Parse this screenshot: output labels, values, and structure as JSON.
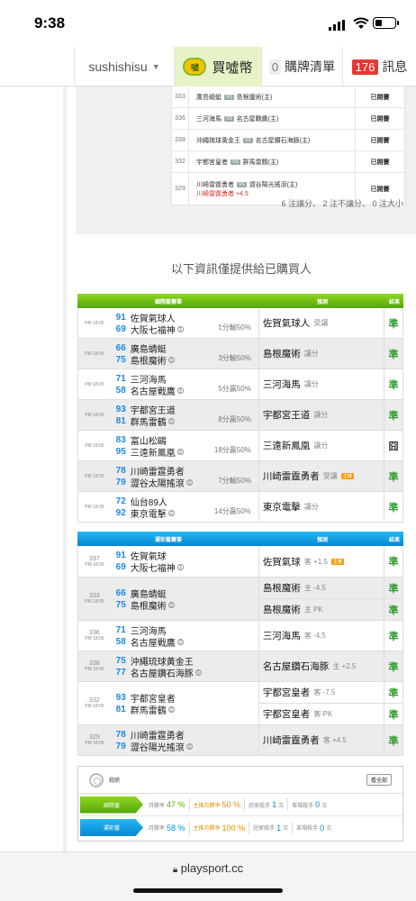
{
  "status": {
    "time": "9:38"
  },
  "nav": {
    "username": "sushishisu",
    "coin_label": "買噓幣",
    "coin_icon_text": "噓",
    "cart_count": "0",
    "cart_label": "購牌清單",
    "msg_count": "176",
    "msg_label": "訊息"
  },
  "prev": {
    "rows": [
      {
        "num": "333",
        "a": "廣島蜻蜓",
        "b": "島根魔術(主)",
        "res": "已開賽"
      },
      {
        "num": "336",
        "a": "三河海馬",
        "b": "名古屋戰鷹(主)",
        "res": "已開賽"
      },
      {
        "num": "338",
        "a": "沖繩琉球黃金王",
        "b": "名古屋鑽石海豚(主)",
        "res": "已開賽"
      },
      {
        "num": "332",
        "a": "宇都宮皇者",
        "b": "群馬雷鶴(主)",
        "res": "已開賽"
      },
      {
        "num": "329",
        "a": "川崎雷霆勇者",
        "b": "澀谷陽光搖滾(主)",
        "res": "已開賽",
        "extra": "川崎雷霆勇者 +4.5"
      }
    ],
    "summary": "6 注讓分、 2 注不讓分、 0 注大小"
  },
  "heading": "以下資訊僅提供給已購買人",
  "t_intl": {
    "h1": "國際盤賽事",
    "h2": "預測",
    "h3": "結果",
    "rows": [
      {
        "time": "PM 18:05",
        "s1": "91",
        "t1": "佐賀氣球人",
        "s2": "69",
        "t2": "大阪七福神",
        "line": "1分輸50%",
        "picks": [
          {
            "name": "佐賀氣球人",
            "x": "受讓"
          }
        ],
        "out": "準"
      },
      {
        "time": "PM 18:05",
        "s1": "66",
        "t1": "廣島蜻蜓",
        "s2": "75",
        "t2": "島根魔術",
        "line": "3分輸50%",
        "picks": [
          {
            "name": "島根魔術",
            "x": "讓分"
          }
        ],
        "out": "準"
      },
      {
        "time": "PM 18:05",
        "s1": "71",
        "t1": "三河海馬",
        "s2": "58",
        "t2": "名古屋戰鷹",
        "line": "5分贏50%",
        "picks": [
          {
            "name": "三河海馬",
            "x": "讓分"
          }
        ],
        "out": "準"
      },
      {
        "time": "PM 18:05",
        "s1": "93",
        "t1": "宇都宮王道",
        "s2": "81",
        "t2": "群馬雷鶴",
        "line": "8分贏50%",
        "picks": [
          {
            "name": "宇都宮王道",
            "x": "讓分"
          }
        ],
        "out": "準"
      },
      {
        "time": "PM 18:05",
        "s1": "83",
        "t1": "富山松鷗",
        "s2": "95",
        "t2": "三遠新鳳凰",
        "line": "18分贏50%",
        "picks": [
          {
            "name": "三遠新鳳凰",
            "x": "讓分"
          }
        ],
        "out": "囧"
      },
      {
        "time": "PM 18:05",
        "s1": "78",
        "t1": "川崎雷霆勇者",
        "s2": "79",
        "t2": "澀谷太陽搖滾",
        "line": "7分輸50%",
        "picks": [
          {
            "name": "川崎雷霆勇者",
            "x": "受讓",
            "tag": "主推"
          }
        ],
        "out": "準"
      },
      {
        "time": "PM 18:35",
        "s1": "72",
        "t1": "仙台89人",
        "s2": "92",
        "t2": "東京電擊",
        "line": "14分贏50%",
        "picks": [
          {
            "name": "東京電擊",
            "x": "讓分"
          }
        ],
        "out": "準"
      }
    ]
  },
  "t_local": {
    "h1": "運彩盤賽事",
    "h2": "預測",
    "h3": "結果",
    "rows": [
      {
        "num": "337",
        "time": "PM 18:05",
        "s1": "91",
        "t1": "佐賀氣球",
        "s2": "69",
        "t2": "大阪七福神",
        "picks": [
          {
            "name": "佐賀氣球",
            "x": "客 +1.5",
            "tag": "主推"
          }
        ],
        "out": "準"
      },
      {
        "num": "333",
        "time": "PM 18:05",
        "s1": "66",
        "t1": "廣島蜻蜓",
        "s2": "75",
        "t2": "島根魔術",
        "picks": [
          {
            "name": "島根魔術",
            "x": "主 -4.5"
          },
          {
            "name": "島根魔術",
            "x": "主 PK"
          }
        ],
        "out": "準",
        "out2": "準"
      },
      {
        "num": "336",
        "time": "PM 18:05",
        "s1": "71",
        "t1": "三河海馬",
        "s2": "58",
        "t2": "名古屋戰鷹",
        "picks": [
          {
            "name": "三河海馬",
            "x": "客 -4.5"
          }
        ],
        "out": "準"
      },
      {
        "num": "338",
        "time": "PM 18:05",
        "s1": "75",
        "t1": "沖繩琉球黃金王",
        "s2": "77",
        "t2": "名古屋鑽石海豚",
        "picks": [
          {
            "name": "名古屋鑽石海豚",
            "x": "主 +2.5"
          }
        ],
        "out": "準"
      },
      {
        "num": "332",
        "time": "PM 18:05",
        "s1": "93",
        "t1": "宇都宮皇者",
        "s2": "81",
        "t2": "群馬雷鶴",
        "picks": [
          {
            "name": "宇都宮皇者",
            "x": "客 -7.5"
          },
          {
            "name": "宇都宮皇者",
            "x": "客 PK"
          }
        ],
        "out": "準",
        "out2": "準"
      },
      {
        "num": "329",
        "time": "PM 18:05",
        "s1": "78",
        "t1": "川崎雷霆勇者",
        "s2": "79",
        "t2": "澀谷陽光搖滾",
        "picks": [
          {
            "name": "川崎雷霆勇者",
            "x": "客 +4.5"
          }
        ],
        "out": "準"
      }
    ]
  },
  "stats": {
    "title": "戰績",
    "all_btn": "看全部",
    "rows": [
      {
        "label": "國際盤",
        "month_label": "月勝率",
        "month": "47 %",
        "main_label": "主推月勝率",
        "main": "50 %",
        "kill_label": "莊家殺手",
        "kill": "1",
        "kill_unit": "次",
        "single_label": "單場殺手",
        "single": "0",
        "single_unit": "次"
      },
      {
        "label": "運彩盤",
        "month_label": "月勝率",
        "month": "58 %",
        "main_label": "主推月勝率",
        "main": "100 %",
        "kill_label": "莊家殺手",
        "kill": "1",
        "kill_unit": "次",
        "single_label": "單場殺手",
        "single": "0",
        "single_unit": "次"
      }
    ]
  },
  "browser": {
    "url": "playsport.cc"
  }
}
